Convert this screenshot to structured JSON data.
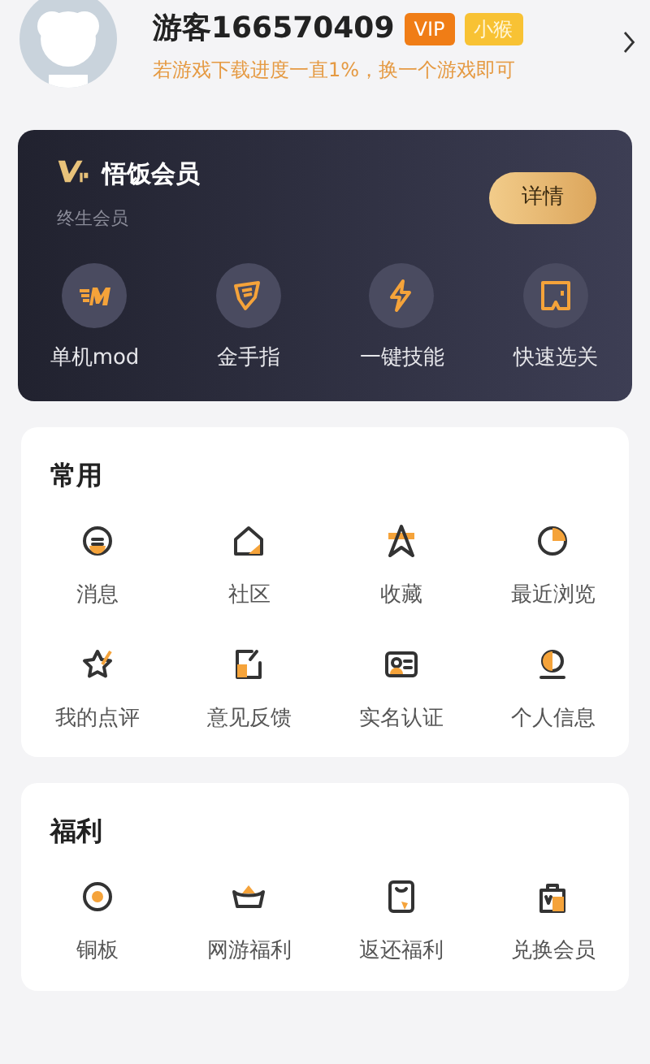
{
  "profile": {
    "name": "游客166570409",
    "badges": [
      "VIP",
      "小猴"
    ],
    "hint": "若游戏下载进度一直1%，换一个游戏即可"
  },
  "vip_card": {
    "title": "悟饭会员",
    "subtitle": "终生会员",
    "button": "详情",
    "items": [
      "单机mod",
      "金手指",
      "一键技能",
      "快速选关"
    ]
  },
  "sections": [
    {
      "title": "常用",
      "items": [
        "消息",
        "社区",
        "收藏",
        "最近浏览",
        "我的点评",
        "意见反馈",
        "实名认证",
        "个人信息"
      ]
    },
    {
      "title": "福利",
      "items": [
        "铜板",
        "网游福利",
        "返还福利",
        "兑换会员"
      ]
    }
  ]
}
